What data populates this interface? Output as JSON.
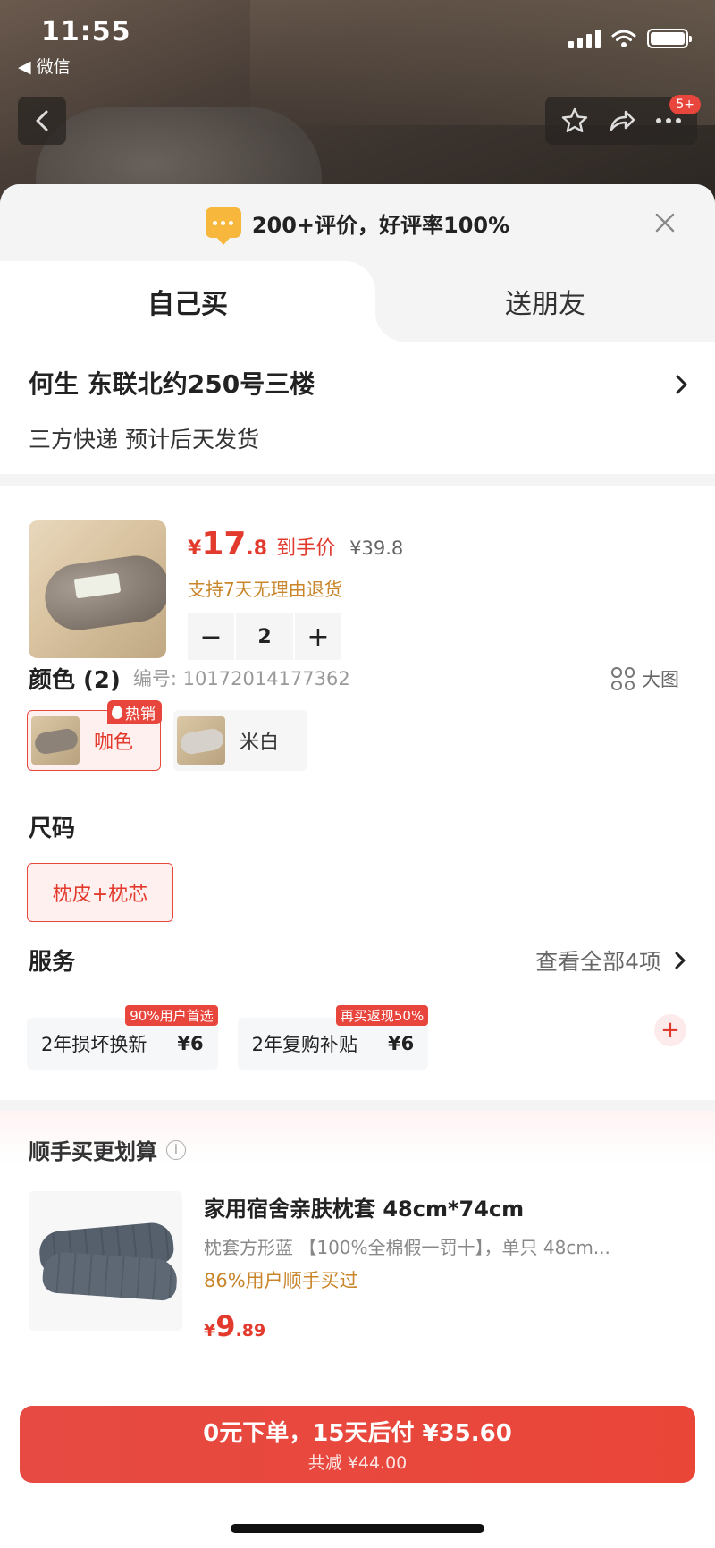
{
  "status": {
    "time": "11:55",
    "back_app": "◀ 微信"
  },
  "nav": {
    "badge": "5+"
  },
  "sheet": {
    "rating": "200+评价，好评率100%"
  },
  "tabs": {
    "self": "自己买",
    "friend": "送朋友"
  },
  "address": {
    "name_line": "何生  东联北约250号三楼",
    "delivery": "三方快递 预计后天发货"
  },
  "product": {
    "price_currency": "¥",
    "price_int": "17",
    "price_dec": ".8",
    "price_label": "到手价",
    "original_price": "¥39.8",
    "return_note": "支持7天无理由退货",
    "quantity": "2",
    "minus": "−",
    "plus": "+"
  },
  "color": {
    "title": "颜色 (2)",
    "sku": "编号: 10172014177362",
    "big_image": "大图",
    "options": [
      {
        "label": "咖色",
        "badge": "热销"
      },
      {
        "label": "米白"
      }
    ]
  },
  "size": {
    "title": "尺码",
    "option": "枕皮+枕芯"
  },
  "services": {
    "title": "服务",
    "view_all": "查看全部4项",
    "items": [
      {
        "name": "2年损坏换新",
        "price": "¥6",
        "tag": "90%用户首选"
      },
      {
        "name": "2年复购补贴",
        "price": "¥6",
        "tag": "再买返现50%"
      }
    ]
  },
  "upsell": {
    "title": "顺手买更划算",
    "info": "i",
    "product_title": "家用宿舍亲肤枕套 48cm*74cm",
    "product_desc": "枕套方形蓝 【100%全棉假一罚十】，单只 48cm...",
    "social": "86%用户顺手买过",
    "price_currency": "¥",
    "price_int": "9",
    "price_dec": ".89",
    "add": "+"
  },
  "buy": {
    "main": "0元下单，15天后付 ¥35.60",
    "sub": "共减 ¥44.00"
  }
}
